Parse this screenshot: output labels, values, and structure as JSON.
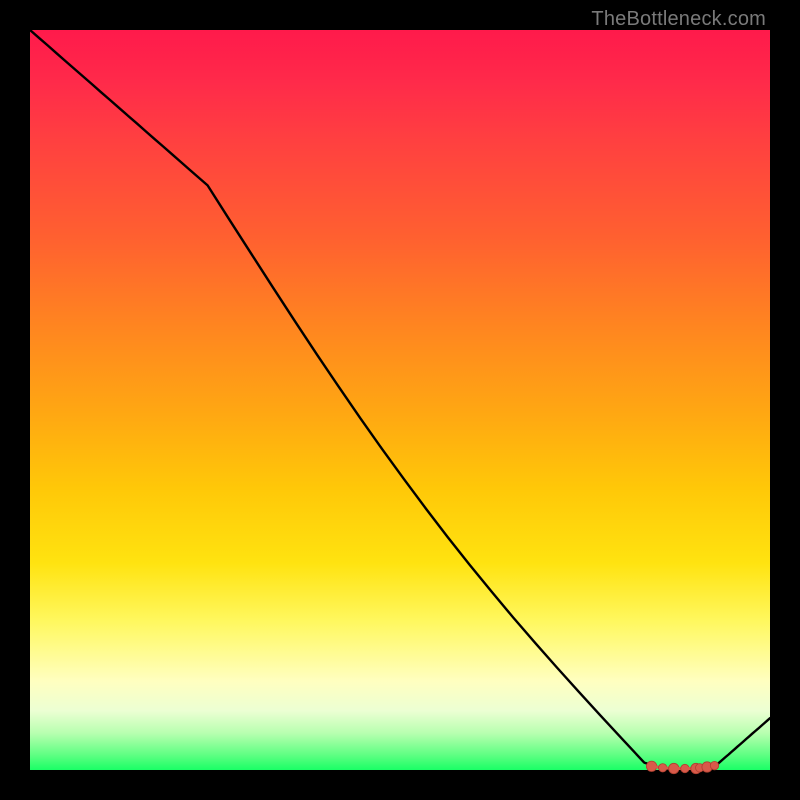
{
  "watermark": "TheBottleneck.com",
  "chart_data": {
    "type": "line",
    "title": "",
    "xlabel": "",
    "ylabel": "",
    "x": [
      0.0,
      0.24,
      0.83,
      0.86,
      0.92,
      1.0
    ],
    "values": [
      1.0,
      0.79,
      0.01,
      0.0,
      0.0,
      0.07
    ],
    "ylim": [
      0,
      1
    ],
    "xlim": [
      0,
      1
    ],
    "minimum_markers": {
      "x": [
        0.84,
        0.855,
        0.87,
        0.885,
        0.9,
        0.905,
        0.915,
        0.925
      ],
      "y": [
        0.005,
        0.003,
        0.002,
        0.002,
        0.002,
        0.003,
        0.004,
        0.006
      ]
    }
  }
}
